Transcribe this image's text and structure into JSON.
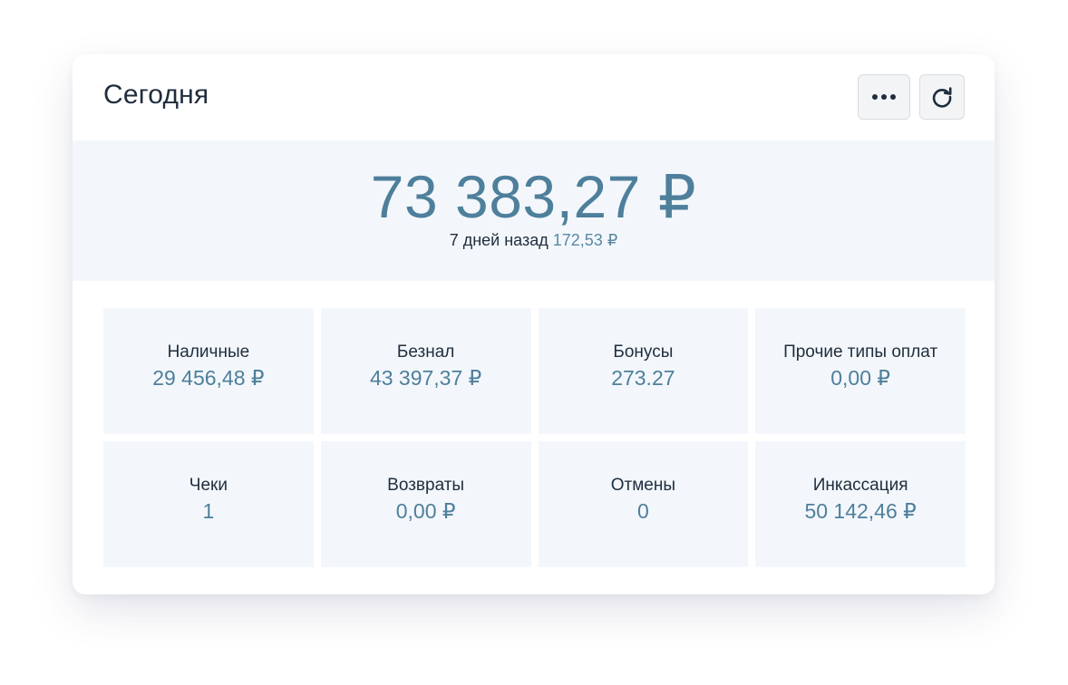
{
  "header": {
    "title": "Сегодня",
    "more_icon": "more-horizontal-icon",
    "refresh_icon": "refresh-icon"
  },
  "summary": {
    "total": "73 383,27 ₽",
    "compare_label": "7 дней назад",
    "compare_value": "172,53 ₽"
  },
  "stats": [
    {
      "label": "Наличные",
      "value": "29 456,48 ₽"
    },
    {
      "label": "Безнал",
      "value": "43 397,37 ₽"
    },
    {
      "label": "Бонусы",
      "value": "273.27"
    },
    {
      "label": "Прочие типы оплат",
      "value": "0,00 ₽"
    },
    {
      "label": "Чеки",
      "value": "1"
    },
    {
      "label": "Возвраты",
      "value": "0,00 ₽"
    },
    {
      "label": "Отмены",
      "value": "0"
    },
    {
      "label": "Инкассация",
      "value": "50 142,46 ₽"
    }
  ],
  "colors": {
    "accent": "#4e7f9b",
    "text": "#1f2d3d",
    "panel": "#f3f7fb"
  }
}
